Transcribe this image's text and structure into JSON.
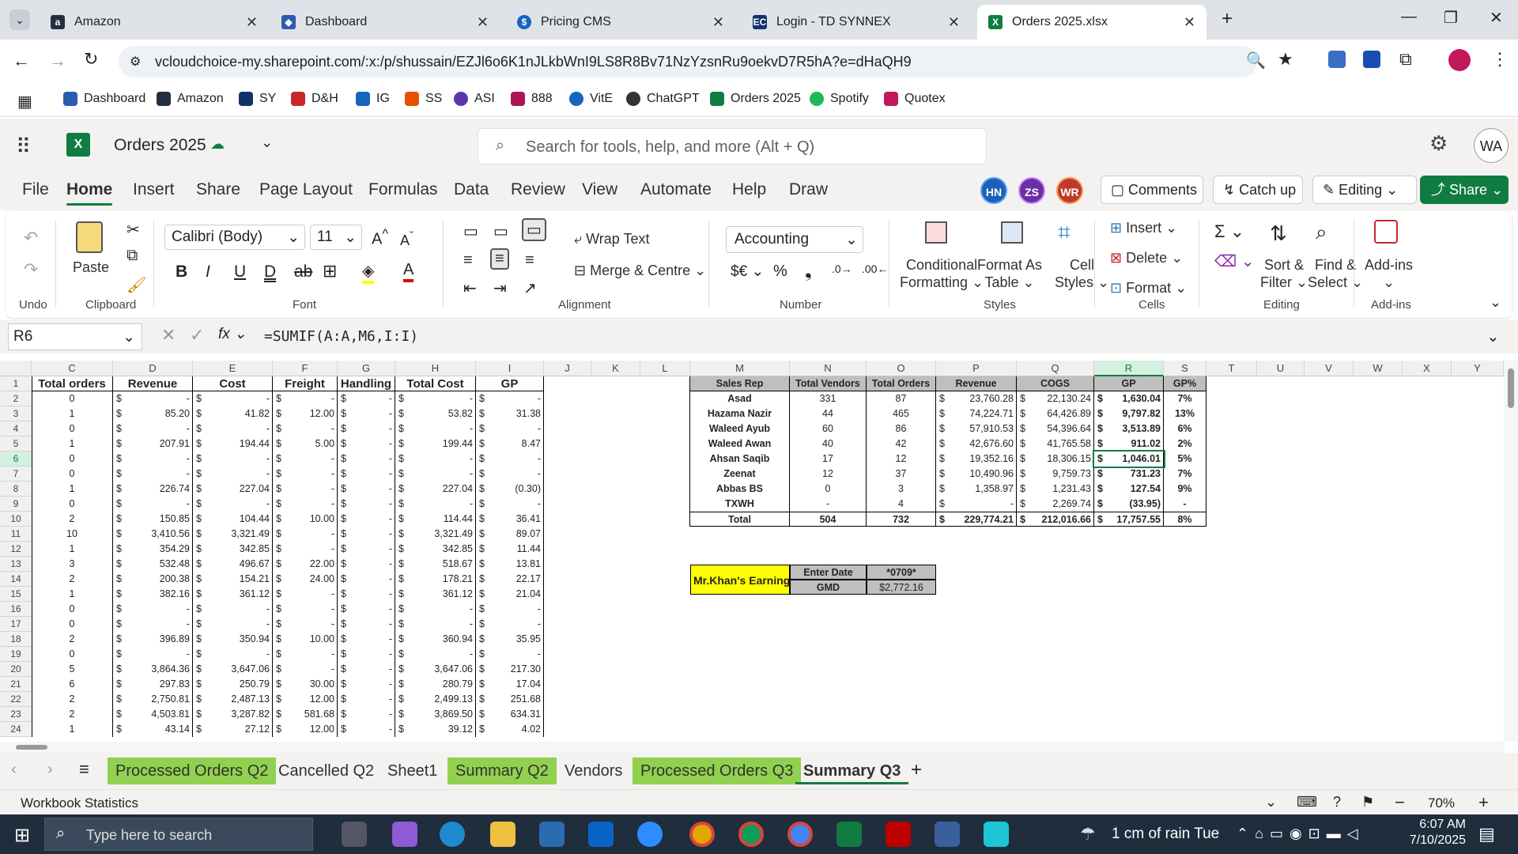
{
  "browser": {
    "tabs": [
      {
        "label": "Amazon"
      },
      {
        "label": "Dashboard"
      },
      {
        "label": "Pricing CMS"
      },
      {
        "label": "Login - TD SYNNEX"
      },
      {
        "label": "Orders 2025.xlsx"
      }
    ],
    "url": "vcloudchoice-my.sharepoint.com/:x:/p/shussain/EZJl6o6K1nJLkbWnI9LS8R8Bv71NzYzsnRu9oekvD7R5hA?e=dHaQH9",
    "bookmarks": [
      "Dashboard",
      "Amazon",
      "SY",
      "D&H",
      "IG",
      "SS",
      "ASI",
      "888",
      "VitE",
      "ChatGPT",
      "Orders 2025",
      "Spotify",
      "Quotex"
    ]
  },
  "app": {
    "title": "Orders 2025",
    "search_placeholder": "Search for tools, help, and more (Alt + Q)",
    "avatar": "WA",
    "coauthors": [
      "HN",
      "ZS",
      "WR"
    ],
    "comments": "Comments",
    "catchup": "Catch up",
    "editing": "Editing",
    "share": "Share"
  },
  "menu": [
    "File",
    "Home",
    "Insert",
    "Share",
    "Page Layout",
    "Formulas",
    "Data",
    "Review",
    "View",
    "Automate",
    "Help",
    "Draw"
  ],
  "ribbon": {
    "undo": "Undo",
    "clipboard": "Clipboard",
    "paste": "Paste",
    "font_name": "Calibri (Body)",
    "font_size": "11",
    "font": "Font",
    "wrap": "Wrap Text",
    "merge": "Merge & Centre",
    "alignment": "Alignment",
    "number_format": "Accounting",
    "number": "Number",
    "cond": "Conditional",
    "cond2": "Formatting",
    "fmt_table": "Format As",
    "fmt_table2": "Table",
    "cell_styles": "Cell",
    "cell_styles2": "Styles",
    "styles": "Styles",
    "insert": "Insert",
    "delete": "Delete",
    "format": "Format",
    "cells": "Cells",
    "sort": "Sort &",
    "sort2": "Filter",
    "find": "Find &",
    "find2": "Select",
    "editing": "Editing",
    "addins": "Add-ins",
    "addins_grp": "Add-ins"
  },
  "formula_bar": {
    "name_box": "R6",
    "formula": "=SUMIF(A:A,M6,I:I)"
  },
  "columns": [
    "C",
    "D",
    "E",
    "F",
    "G",
    "H",
    "I",
    "J",
    "K",
    "L",
    "M",
    "N",
    "O",
    "P",
    "Q",
    "R",
    "S",
    "T",
    "U",
    "V",
    "W",
    "X",
    "Y"
  ],
  "left_table": {
    "headers": [
      "Total orders",
      "Revenue",
      "Cost",
      "Freight",
      "Handling",
      "Total Cost",
      "GP"
    ],
    "rows": [
      [
        "0",
        "-",
        "-",
        "-",
        "-",
        "-",
        "-"
      ],
      [
        "1",
        "85.20",
        "41.82",
        "12.00",
        "-",
        "53.82",
        "31.38"
      ],
      [
        "0",
        "-",
        "-",
        "-",
        "-",
        "-",
        "-"
      ],
      [
        "1",
        "207.91",
        "194.44",
        "5.00",
        "-",
        "199.44",
        "8.47"
      ],
      [
        "0",
        "-",
        "-",
        "-",
        "-",
        "-",
        "-"
      ],
      [
        "0",
        "-",
        "-",
        "-",
        "-",
        "-",
        "-"
      ],
      [
        "1",
        "226.74",
        "227.04",
        "-",
        "-",
        "227.04",
        "(0.30)"
      ],
      [
        "0",
        "-",
        "-",
        "-",
        "-",
        "-",
        "-"
      ],
      [
        "2",
        "150.85",
        "104.44",
        "10.00",
        "-",
        "114.44",
        "36.41"
      ],
      [
        "10",
        "3,410.56",
        "3,321.49",
        "-",
        "-",
        "3,321.49",
        "89.07"
      ],
      [
        "1",
        "354.29",
        "342.85",
        "-",
        "-",
        "342.85",
        "11.44"
      ],
      [
        "3",
        "532.48",
        "496.67",
        "22.00",
        "-",
        "518.67",
        "13.81"
      ],
      [
        "2",
        "200.38",
        "154.21",
        "24.00",
        "-",
        "178.21",
        "22.17"
      ],
      [
        "1",
        "382.16",
        "361.12",
        "-",
        "-",
        "361.12",
        "21.04"
      ],
      [
        "0",
        "-",
        "-",
        "-",
        "-",
        "-",
        "-"
      ],
      [
        "0",
        "-",
        "-",
        "-",
        "-",
        "-",
        "-"
      ],
      [
        "2",
        "396.89",
        "350.94",
        "10.00",
        "-",
        "360.94",
        "35.95"
      ],
      [
        "0",
        "-",
        "-",
        "-",
        "-",
        "-",
        "-"
      ],
      [
        "5",
        "3,864.36",
        "3,647.06",
        "-",
        "-",
        "3,647.06",
        "217.30"
      ],
      [
        "6",
        "297.83",
        "250.79",
        "30.00",
        "-",
        "280.79",
        "17.04"
      ],
      [
        "2",
        "2,750.81",
        "2,487.13",
        "12.00",
        "-",
        "2,499.13",
        "251.68"
      ],
      [
        "2",
        "4,503.81",
        "3,287.82",
        "581.68",
        "-",
        "3,869.50",
        "634.31"
      ],
      [
        "1",
        "43.14",
        "27.12",
        "12.00",
        "-",
        "39.12",
        "4.02"
      ]
    ]
  },
  "summary_table": {
    "headers": [
      "Sales Rep",
      "Total Vendors",
      "Total Orders",
      "Revenue",
      "COGS",
      "GP",
      "GP%"
    ],
    "rows": [
      [
        "Asad",
        "331",
        "87",
        "23,760.28",
        "22,130.24",
        "1,630.04",
        "7%"
      ],
      [
        "Hazama Nazir",
        "44",
        "465",
        "74,224.71",
        "64,426.89",
        "9,797.82",
        "13%"
      ],
      [
        "Waleed Ayub",
        "60",
        "86",
        "57,910.53",
        "54,396.64",
        "3,513.89",
        "6%"
      ],
      [
        "Waleed Awan",
        "40",
        "42",
        "42,676.60",
        "41,765.58",
        "911.02",
        "2%"
      ],
      [
        "Ahsan Saqib",
        "17",
        "12",
        "19,352.16",
        "18,306.15",
        "1,046.01",
        "5%"
      ],
      [
        "Zeenat",
        "12",
        "37",
        "10,490.96",
        "9,759.73",
        "731.23",
        "7%"
      ],
      [
        "Abbas BS",
        "0",
        "3",
        "1,358.97",
        "1,231.43",
        "127.54",
        "9%"
      ],
      [
        "TXWH",
        "-",
        "4",
        "-",
        "2,269.74",
        "(33.95)",
        "-"
      ],
      [
        "Total",
        "504",
        "732",
        "229,774.21",
        "212,016.66",
        "17,757.55",
        "8%"
      ]
    ]
  },
  "khan": {
    "label": "Mr.Khan's Earning",
    "enter_date": "Enter Date",
    "date_val": "*0709*",
    "gmd": "GMD",
    "gmd_val": "$2,772.16"
  },
  "sheets": [
    "Processed Orders Q2",
    "Cancelled Q2",
    "Sheet1",
    "Summary Q2",
    "Vendors",
    "Processed Orders Q3",
    "Summary Q3"
  ],
  "status": {
    "left": "Workbook Statistics",
    "zoom": "70%"
  },
  "taskbar": {
    "search": "Type here to search",
    "weather": "1 cm of rain Tue",
    "time": "6:07 AM",
    "date": "7/10/2025"
  }
}
